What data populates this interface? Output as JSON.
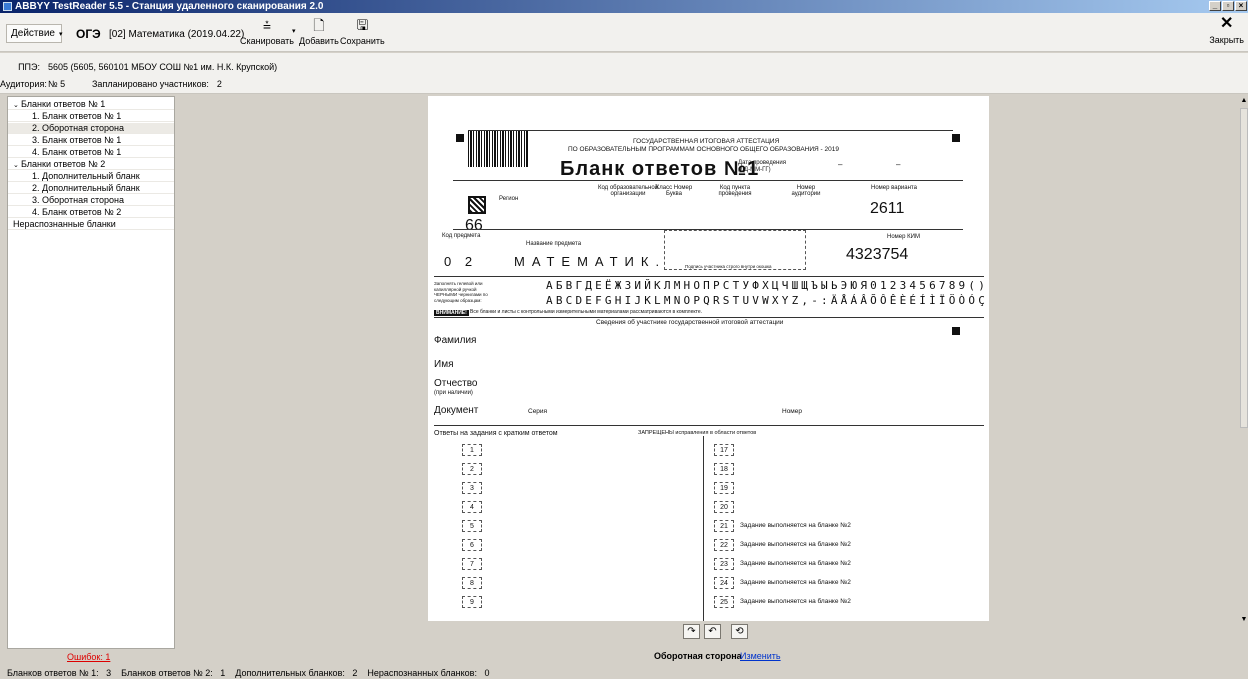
{
  "window": {
    "title": "ABBYY TestReader 5.5 - Станция удаленного сканирования 2.0",
    "controls": [
      "_",
      "▫",
      "×"
    ]
  },
  "toolbar": {
    "action_label": "Действие",
    "exam_code": "ОГЭ",
    "exam_subject": "[02] Математика (2019.04.22)",
    "scan_label": "Сканировать",
    "add_label": "Добавить",
    "save_label": "Сохранить",
    "close_label": "Закрыть"
  },
  "info": {
    "ppe_label": "ППЭ:",
    "ppe_value": "5605 (5605, 560101 МБОУ СОШ №1 им. Н.К. Крупской)",
    "room_label": "Аудитория:",
    "room_value": "№ 5",
    "planned_label": "Запланировано участников:",
    "planned_value": "2"
  },
  "tree": [
    {
      "label": "Бланки ответов № 1",
      "level": 0,
      "toggle": "⌄"
    },
    {
      "label": "1. Бланк ответов № 1",
      "level": 1
    },
    {
      "label": "2. Оборотная сторона",
      "level": 1,
      "selected": true
    },
    {
      "label": "3. Бланк ответов № 1",
      "level": 1
    },
    {
      "label": "4. Бланк ответов № 1",
      "level": 1
    },
    {
      "label": "Бланки ответов № 2",
      "level": 0,
      "toggle": "⌄"
    },
    {
      "label": "1. Дополнительный бланк",
      "level": 1
    },
    {
      "label": "2. Дополнительный бланк",
      "level": 1
    },
    {
      "label": "3. Оборотная сторона",
      "level": 1
    },
    {
      "label": "4. Бланк ответов № 2",
      "level": 1
    },
    {
      "label": "Нераспознанные бланки",
      "level": 0
    }
  ],
  "errors_link": "Ошибок: 1",
  "status": {
    "text": "Бланков ответов № 1:   3    Бланков ответов № 2:   1    Дополнительных бланков:   2    Нераспознанных бланков:   0"
  },
  "form": {
    "header_line1": "ГОСУДАРСТВЕННАЯ ИТОГОВАЯ АТТЕСТАЦИЯ",
    "header_line2": "ПО ОБРАЗОВАТЕЛЬНЫМ ПРОГРАММАМ ОСНОВНОГО ОБЩЕГО ОБРАЗОВАНИЯ - 2019",
    "title": "Бланк ответов №1",
    "date_label": "Дата проведения (ДД-ММ-ГГ)",
    "region_label": "Регион",
    "region_value": "66",
    "org_code_label": "Код образовательной организации",
    "class_label": "Класс Номер Буква",
    "point_label": "Код пункта проведения",
    "room_label": "Номер аудитории",
    "variant_label": "Номер варианта",
    "variant_value": "2611",
    "subject_code_label": "Код предмета",
    "subject_code_value": "0 2",
    "subject_name_label": "Название предмета",
    "subject_name_value": "МАТЕМАТИК.",
    "signature_label": "Подпись участника строго внутри окошка",
    "kim_label": "Номер КИМ",
    "kim_value": "4323754",
    "sample_label": "Заполнять гелевой или капиллярной ручкой ЧЕРНЫМИ чернилами по следующим образцам:",
    "sample_row1": "АБВГДЕЁЖЗИЙКЛМНОПРСТУФХЦЧШЩЪЫЬЭЮЯ0123456789()",
    "sample_row2": "ABCDEFGHIJKLMNOPQRSTUVWXYZ,-:ÄÅÁÂÕÔÊÈÉÍÌÏÖÒÓÇ",
    "attention_label": "ВНИМАНИЕ!",
    "attention_text": "Все бланки и листы с контрольными измерительными материалами рассматриваются в комплекте.",
    "participant_header": "Сведения об участнике государственной итоговой аттестации",
    "surname_label": "Фамилия",
    "name_label": "Имя",
    "patronymic_label": "Отчество",
    "patronymic_note": "(при наличии)",
    "document_label": "Документ",
    "series_label": "Серия",
    "number_label": "Номер",
    "answers_header": "Ответы на задания с кратким ответом",
    "forbidden_note": "ЗАПРЕЩЕНЫ исправления в области ответов",
    "left_tasks": [
      "1",
      "2",
      "3",
      "4",
      "5",
      "6",
      "7",
      "8",
      "9"
    ],
    "right_tasks": [
      {
        "num": "17",
        "text": ""
      },
      {
        "num": "18",
        "text": ""
      },
      {
        "num": "19",
        "text": ""
      },
      {
        "num": "20",
        "text": ""
      },
      {
        "num": "21",
        "text": "Задание выполняется на бланке №2"
      },
      {
        "num": "22",
        "text": "Задание выполняется на бланке №2"
      },
      {
        "num": "23",
        "text": "Задание выполняется на бланке №2"
      },
      {
        "num": "24",
        "text": "Задание выполняется на бланке №2"
      },
      {
        "num": "25",
        "text": "Задание выполняется на бланке №2"
      }
    ]
  },
  "viewer": {
    "rotate_right_glyph": "↷",
    "rotate_left_glyph": "↶",
    "flip_glyph": "⟲",
    "side_label": "Оборотная сторона",
    "change_link": "Изменить"
  }
}
